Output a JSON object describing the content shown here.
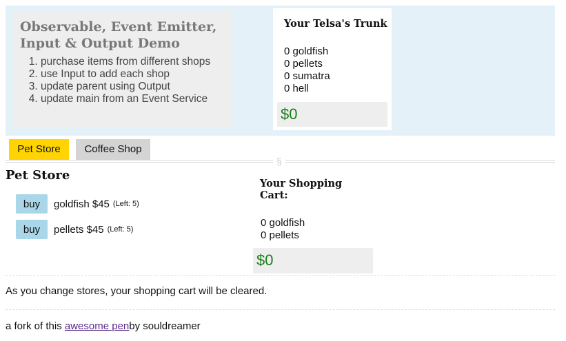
{
  "header": {
    "title": "Observable, Event Emitter, Input & Output Demo",
    "steps": [
      "purchase items from different shops",
      "use Input to add each shop",
      "update parent using Output",
      "update main from an Event Service"
    ]
  },
  "trunk": {
    "title": "Your Telsa's Trunk",
    "items": [
      "0 goldfish",
      "0 pellets",
      "0 sumatra",
      "0 hell"
    ],
    "total": "$0"
  },
  "tabs": [
    {
      "label": "Pet Store",
      "active": true
    },
    {
      "label": "Coffee Shop",
      "active": false
    }
  ],
  "section_mark": "§",
  "store": {
    "title": "Pet Store",
    "products": [
      {
        "button": "buy",
        "name": "goldfish $45",
        "left": "(Left: 5)"
      },
      {
        "button": "buy",
        "name": "pellets $45",
        "left": "(Left: 5)"
      }
    ]
  },
  "cart": {
    "title": "Your Shopping Cart:",
    "items": [
      "0 goldfish",
      "0 pellets"
    ],
    "total": "$0"
  },
  "note": "As you change stores, your shopping cart will be cleared.",
  "footer": {
    "prefix": "a fork of this ",
    "link_text": "awesome pen",
    "suffix": "by souldreamer"
  },
  "colors": {
    "header_bg": "#e5f1f8",
    "active_tab": "#ffd400",
    "buy_button": "#a9d6e8",
    "total_text": "#1a7f1a",
    "link": "#5a2a8a"
  }
}
